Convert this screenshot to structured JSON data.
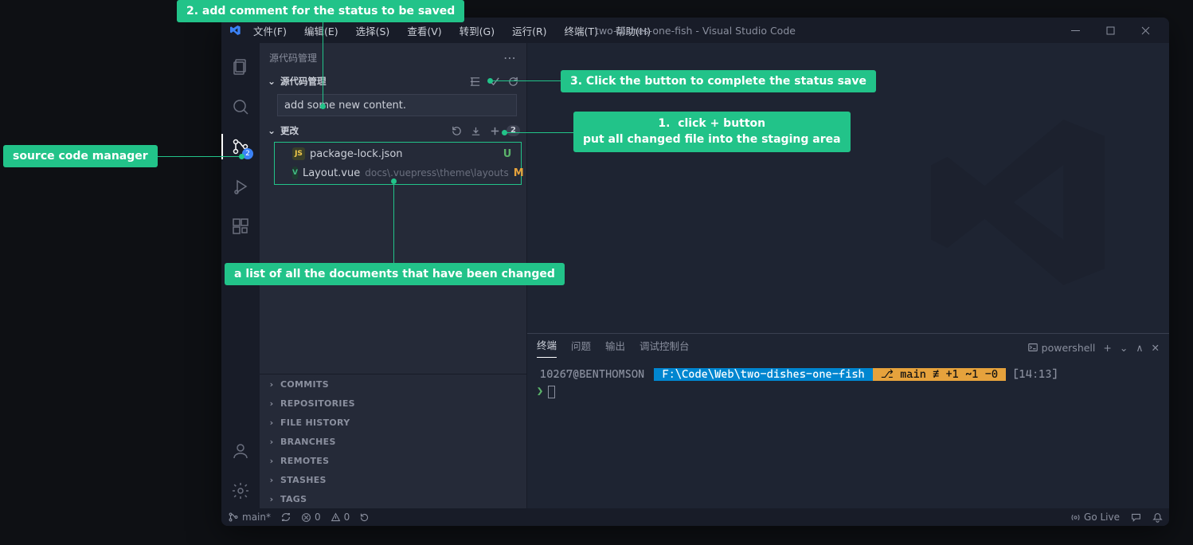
{
  "window": {
    "title": "two-dishes-one-fish - Visual Studio Code"
  },
  "menubar": {
    "items": [
      "文件(F)",
      "编辑(E)",
      "选择(S)",
      "查看(V)",
      "转到(G)",
      "运行(R)",
      "终端(T)",
      "帮助(H)"
    ]
  },
  "activitybar": {
    "scm_badge": "2"
  },
  "sidebar": {
    "title": "源代码管理",
    "scm_section": "源代码管理",
    "commit_message": "add some new content.",
    "changes_label": "更改",
    "changes_count": "2",
    "files": [
      {
        "icon": "JS",
        "icon_color": "#f2c94c",
        "name": "package-lock.json",
        "path": "",
        "status": "U"
      },
      {
        "icon": "V",
        "icon_color": "#41b883",
        "name": "Layout.vue",
        "path": "docs\\.vuepress\\theme\\layouts",
        "status": "M"
      }
    ],
    "collapsed": [
      "COMMITS",
      "REPOSITORIES",
      "FILE HISTORY",
      "BRANCHES",
      "REMOTES",
      "STASHES",
      "TAGS"
    ]
  },
  "terminal": {
    "tabs": [
      "终端",
      "问题",
      "输出",
      "调试控制台"
    ],
    "active_tab": 0,
    "shell_label": "powershell",
    "host": "10267@BENTHOMSON",
    "path": "F:\\Code\\Web\\two-dishes-one-fish",
    "git": "⎇ main ≢ +1 ~1 -0",
    "time": "[14:13]"
  },
  "statusbar": {
    "branch": "main*",
    "errors": "0",
    "warnings": "0",
    "golive": "Go Live"
  },
  "annotations": {
    "a1": "source code manager",
    "a2": "2. add comment for the status to be saved",
    "a3": "3. Click the button to complete the status save",
    "a4_line1": "1.  click + button",
    "a4_line2": "put all changed file into the staging area",
    "a5": "a list of all the documents that have been changed"
  }
}
